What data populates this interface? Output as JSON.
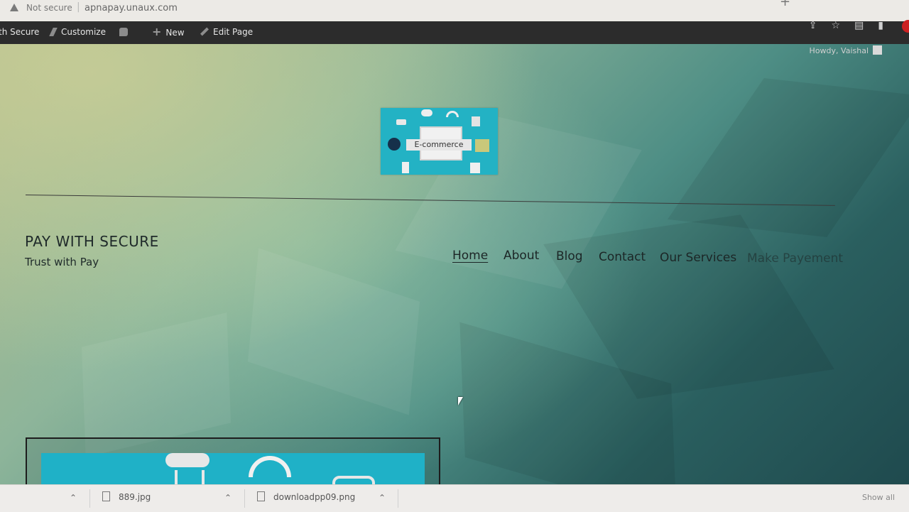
{
  "browser": {
    "security_label": "Not secure",
    "separator": "|",
    "url": "apnapay.unaux.com",
    "new_tab_glyph": "+",
    "right_icons": [
      "share-icon",
      "star-icon",
      "extensions-icon",
      "sidebar-icon"
    ]
  },
  "admin_bar": {
    "site_name": "th Secure",
    "customize": "Customize",
    "new": "New",
    "edit_page": "Edit Page",
    "howdy": "Howdy, Vaishal",
    "comments_icon": "comment-icon",
    "new_icon": "plus-icon"
  },
  "logo": {
    "label": "E-commerce"
  },
  "site": {
    "title": "PAY WITH SECURE",
    "tagline": "Trust with Pay"
  },
  "nav": {
    "items": [
      "Home",
      "About",
      "Blog",
      "Contact",
      "Our Services",
      "Make Payement"
    ],
    "current": "Home"
  },
  "downloads": {
    "items": [
      "889.jpg",
      "downloadpp09.png"
    ],
    "show_all": "Show all"
  }
}
